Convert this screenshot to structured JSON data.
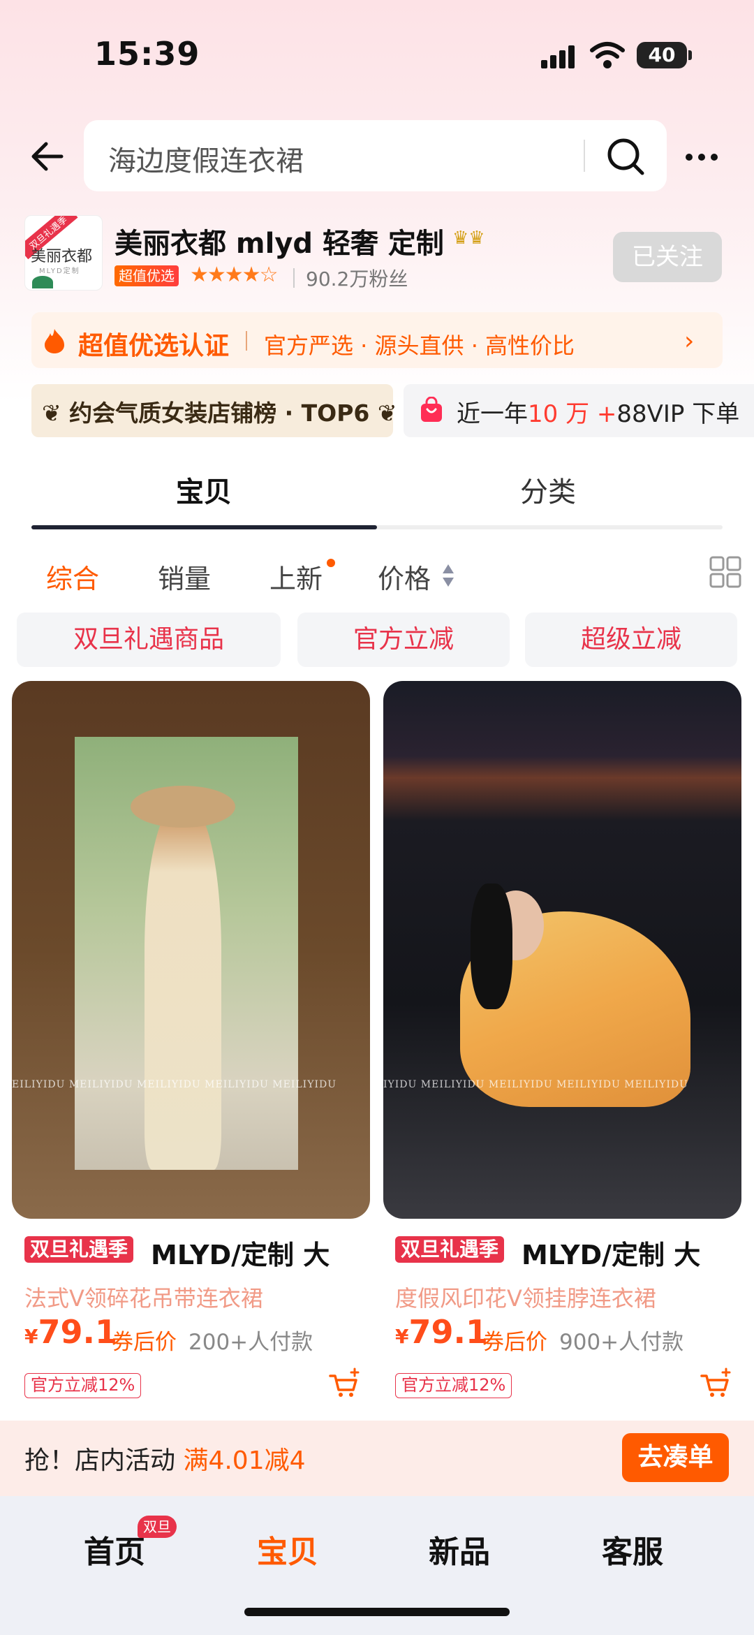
{
  "status_bar": {
    "time": "15:39",
    "battery": "40"
  },
  "search": {
    "query": "海边度假连衣裙"
  },
  "shop": {
    "logo_tag": "双旦礼遇季",
    "logo_text": "美丽衣都",
    "logo_sub": "MLYD定制",
    "name": "美丽衣都 mlyd 轻奢 定制",
    "badge": "超值优选",
    "stars": "★★★★☆",
    "fans": "90.2万粉丝",
    "follow_label": "已关注"
  },
  "cert": {
    "title": "超值优选认证",
    "desc": "官方严选 · 源头直供 · 高性价比",
    "arrow": "›"
  },
  "rank": {
    "text": "约会气质女装店铺榜 · TOP6"
  },
  "vip": {
    "pre": "近一年",
    "highlight": "10 万 +",
    "post": "88VIP 下单"
  },
  "tabs": [
    {
      "label": "宝贝"
    },
    {
      "label": "分类"
    }
  ],
  "sort": {
    "items": [
      "综合",
      "销量",
      "上新",
      "价格"
    ]
  },
  "chips": [
    "双旦礼遇商品",
    "官方立减",
    "超级立减"
  ],
  "products": [
    {
      "promo": "双旦礼遇季",
      "title_a": "MLYD/定制 大",
      "title_b": "法式V领碎花吊带连衣裙",
      "currency": "¥",
      "price": "79.1",
      "after_label": "券后价",
      "sold": "200+人付款",
      "reduce": "官方立减12%",
      "watermark": "EILIYIDU    MEILIYIDU    MEILIYIDU    MEILIYIDU    MEILIYIDU"
    },
    {
      "promo": "双旦礼遇季",
      "title_a": "MLYD/定制 大",
      "title_b": "度假风印花V领挂脖连衣裙",
      "currency": "¥",
      "price": "79.1",
      "after_label": "券后价",
      "sold": "900+人付款",
      "reduce": "官方立减12%",
      "watermark": "IYIDU    MEILIYIDU    MEILIYIDU    MEILIYIDU    MEILIYIDU"
    }
  ],
  "activity": {
    "pre": "抢！店内活动 ",
    "highlight": "满4.01减4",
    "button": "去凑单"
  },
  "bottom_nav": {
    "items": [
      "首页",
      "宝贝",
      "新品",
      "客服"
    ],
    "badge": "双旦"
  },
  "colors": {
    "accent": "#ff5a00",
    "red": "#e8334a",
    "dark": "#1f2333"
  }
}
